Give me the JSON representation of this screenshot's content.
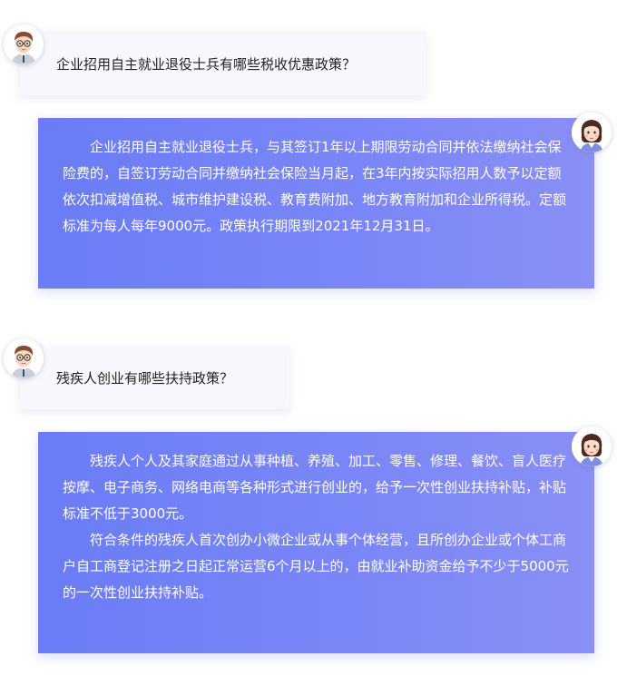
{
  "conversation": [
    {
      "question": {
        "speaker_icon": "male-avatar",
        "text": "企业招用自主就业退役士兵有哪些税收优惠政策？"
      },
      "answer": {
        "speaker_icon": "female-avatar",
        "paragraphs": [
          "企业招用自主就业退役士兵，与其签订1年以上期限劳动合同并依法缴纳社会保险费的，自签订劳动合同并缴纳社会保险当月起，在3年内按实际招用人数予以定额依次扣减增值税、城市维护建设税、教育费附加、地方教育附加和企业所得税。定额标准为每人每年9000元。政策执行期限到2021年12月31日。"
        ]
      }
    },
    {
      "question": {
        "speaker_icon": "male-avatar",
        "text": "残疾人创业有哪些扶持政策？"
      },
      "answer": {
        "speaker_icon": "female-avatar",
        "paragraphs": [
          "残疾人个人及其家庭通过从事种植、养殖、加工、零售、修理、餐饮、盲人医疗按摩、电子商务、网络电商等各种形式进行创业的，给予一次性创业扶持补贴，补贴标准不低于3000元。",
          "符合条件的残疾人首次创办小微企业或从事个体经营，且所创办企业或个体工商户自工商登记注册之日起正常运营6个月以上的，由就业补助资金给予不少于5000元的一次性创业扶持补贴。"
        ]
      }
    }
  ],
  "colors": {
    "question_bg": "#f6f8fd",
    "answer_gradient_start": "#6a7cf6",
    "answer_gradient_end": "#8a8ff6",
    "question_text": "#222222",
    "answer_text": "#ffffff"
  }
}
